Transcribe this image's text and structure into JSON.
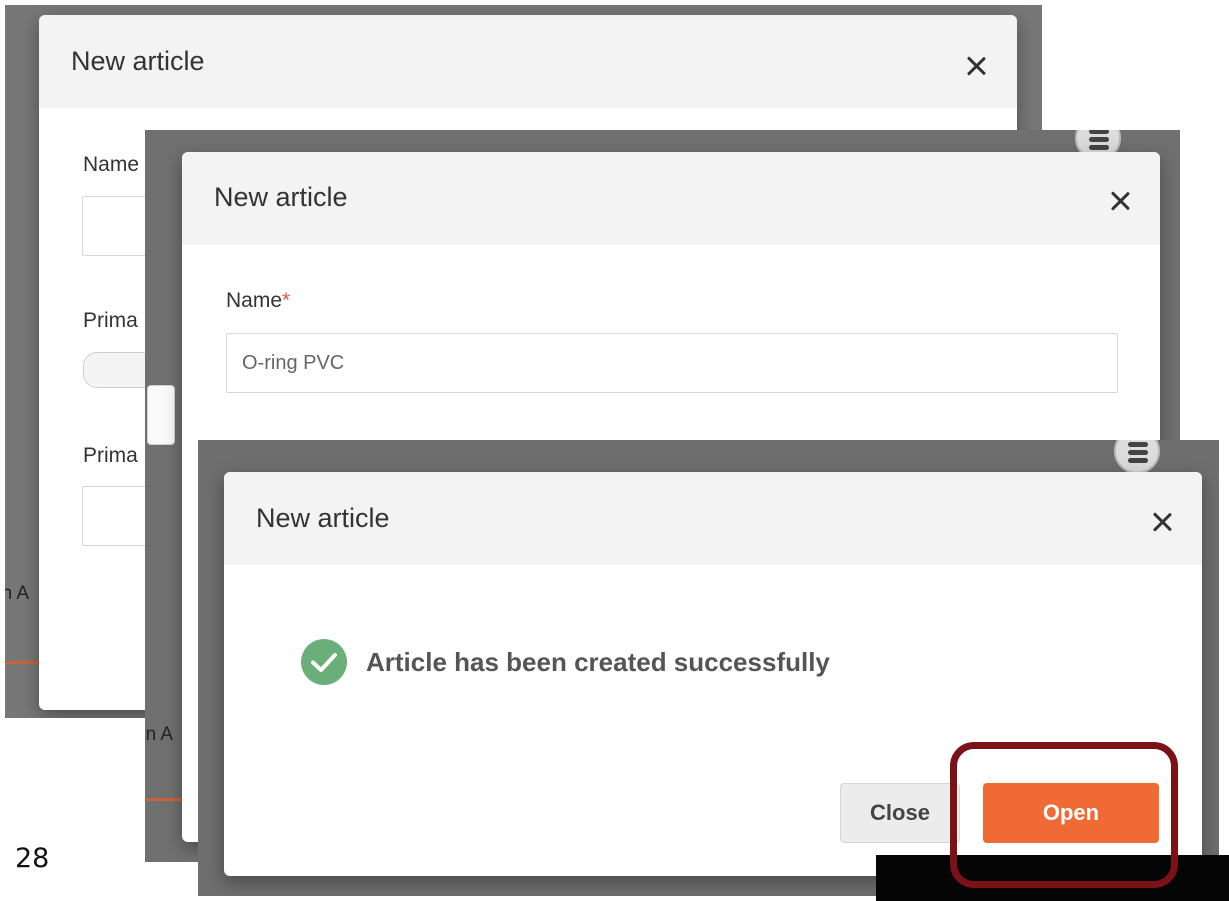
{
  "slide": {
    "page_number": "28"
  },
  "dialog_back": {
    "title": "New article",
    "fields": [
      "Name",
      "Prima",
      "Prima"
    ],
    "fragment": "an A"
  },
  "dialog_middle": {
    "title": "New article",
    "name_label": "Name",
    "required_mark": "*",
    "name_value": "O-ring PVC",
    "fragment": "an A"
  },
  "dialog_front": {
    "title": "New article",
    "message": "Article has been created successfully",
    "close_label": "Close",
    "open_label": "Open"
  },
  "colors": {
    "accent": "#ef6a34",
    "success": "#6aaf7a",
    "highlight": "#7c1218",
    "required": "#d9534f"
  },
  "icons": [
    "close-icon",
    "check-circle-icon",
    "database-icon"
  ]
}
